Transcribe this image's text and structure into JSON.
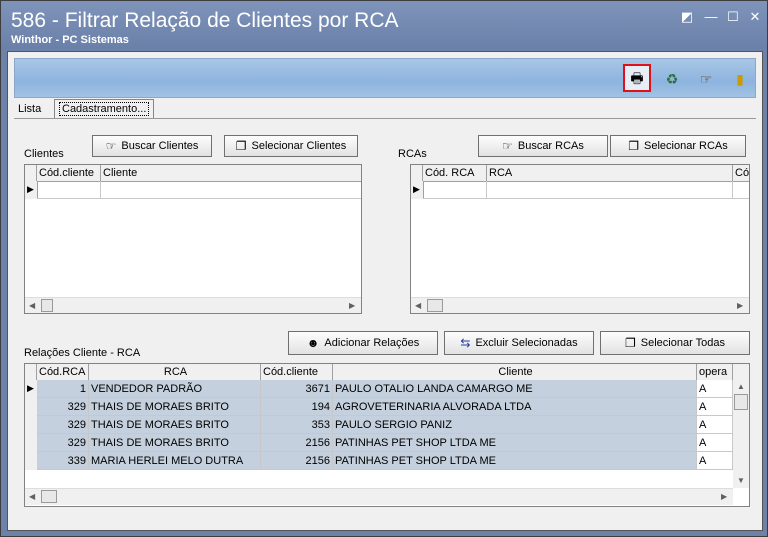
{
  "window": {
    "title": "586 - Filtrar Relação de Clientes por RCA",
    "subtitle": "Winthor - PC Sistemas",
    "controls": [
      "◩",
      "—",
      "☐",
      "✕"
    ]
  },
  "toolbar": {
    "icons": [
      "printer-icon",
      "refresh-icon",
      "search-icon",
      "exit-door-icon"
    ],
    "glyphs": [
      "🖶",
      "♻",
      "☞",
      "▮"
    ]
  },
  "tabs": [
    "Lista",
    "Cadastramento..."
  ],
  "clientes": {
    "label": "Clientes",
    "buscar_label": "Buscar Clientes",
    "selecionar_label": "Selecionar Clientes",
    "columns": [
      "Cód.cliente",
      "Cliente"
    ]
  },
  "rcas": {
    "label": "RCAs",
    "buscar_label": "Buscar RCAs",
    "selecionar_label": "Selecionar RCAs",
    "columns": [
      "Cód. RCA",
      "RCA",
      "Cód"
    ]
  },
  "relacoes": {
    "label": "Relações Cliente - RCA",
    "adicionar_label": "Adicionar Relações",
    "excluir_label": "Excluir Selecionadas",
    "selecionar_todas_label": "Selecionar Todas",
    "columns": [
      "Cód.RCA",
      "RCA",
      "Cód.cliente",
      "Cliente",
      "opera"
    ],
    "rows": [
      {
        "cod_rca": "1",
        "rca": "VENDEDOR PADRÃO",
        "cod_cliente": "3671",
        "cliente": "PAULO OTALIO LANDA CAMARGO ME",
        "opera": "A"
      },
      {
        "cod_rca": "329",
        "rca": "THAIS DE MORAES BRITO",
        "cod_cliente": "194",
        "cliente": "AGROVETERINARIA ALVORADA LTDA",
        "opera": "A"
      },
      {
        "cod_rca": "329",
        "rca": "THAIS DE MORAES BRITO",
        "cod_cliente": "353",
        "cliente": "PAULO SERGIO PANIZ",
        "opera": "A"
      },
      {
        "cod_rca": "329",
        "rca": "THAIS DE MORAES BRITO",
        "cod_cliente": "2156",
        "cliente": "PATINHAS PET SHOP LTDA ME",
        "opera": "A"
      },
      {
        "cod_rca": "339",
        "rca": "MARIA HERLEI MELO DUTRA",
        "cod_cliente": "2156",
        "cliente": "PATINHAS PET SHOP LTDA ME",
        "opera": "A"
      }
    ]
  }
}
